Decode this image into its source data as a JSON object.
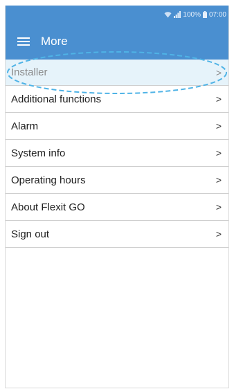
{
  "status_bar": {
    "battery": "100%",
    "time": "07:00",
    "icons": [
      "wifi-icon",
      "signal-icon",
      "battery-icon"
    ]
  },
  "header": {
    "title": "More",
    "menu_icon": "hamburger-menu-icon"
  },
  "menu": {
    "items": [
      {
        "label": "Installer",
        "chevron": ">"
      },
      {
        "label": "Additional functions",
        "chevron": ">"
      },
      {
        "label": "Alarm",
        "chevron": ">"
      },
      {
        "label": "System info",
        "chevron": ">"
      },
      {
        "label": "Operating hours",
        "chevron": ">"
      },
      {
        "label": "About Flexit GO",
        "chevron": ">"
      },
      {
        "label": "Sign out",
        "chevron": ">"
      }
    ]
  },
  "colors": {
    "appbar": "#4a8fd0",
    "highlight_fill": "#e6f3fa",
    "highlight_outline": "#4fb3e6"
  }
}
